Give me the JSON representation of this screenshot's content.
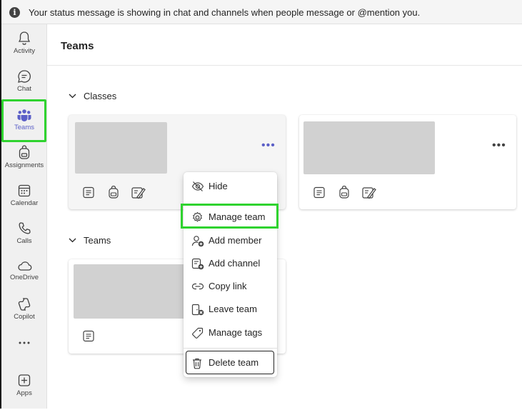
{
  "banner": {
    "message": "Your status message is showing in chat and channels when people message or @mention you.",
    "icon": "info-icon"
  },
  "rail": {
    "items": [
      {
        "label": "Activity",
        "icon": "bell-icon"
      },
      {
        "label": "Chat",
        "icon": "chat-icon"
      },
      {
        "label": "Teams",
        "icon": "teams-icon",
        "active": true
      },
      {
        "label": "Assignments",
        "icon": "backpack-icon"
      },
      {
        "label": "Calendar",
        "icon": "calendar-icon"
      },
      {
        "label": "Calls",
        "icon": "phone-icon"
      },
      {
        "label": "OneDrive",
        "icon": "cloud-icon"
      },
      {
        "label": "Copilot",
        "icon": "copilot-icon"
      },
      {
        "label": "",
        "icon": "more-apps-icon"
      },
      {
        "label": "Apps",
        "icon": "add-app-icon"
      }
    ]
  },
  "page": {
    "title": "Teams"
  },
  "sections": {
    "classes": {
      "label": "Classes"
    },
    "teams": {
      "label": "Teams"
    }
  },
  "menu": {
    "items": [
      {
        "label": "Hide",
        "icon": "hide-icon"
      },
      {
        "label": "Manage team",
        "icon": "gear-icon"
      },
      {
        "label": "Add member",
        "icon": "add-member-icon"
      },
      {
        "label": "Add channel",
        "icon": "add-channel-icon"
      },
      {
        "label": "Copy link",
        "icon": "link-icon"
      },
      {
        "label": "Leave team",
        "icon": "leave-team-icon"
      },
      {
        "label": "Manage tags",
        "icon": "tag-icon"
      },
      {
        "label": "Delete team",
        "icon": "trash-icon"
      }
    ]
  },
  "colors": {
    "accent": "#5b5fc7",
    "highlight": "#2fd32f",
    "placeholder": "#d1d1d1"
  }
}
